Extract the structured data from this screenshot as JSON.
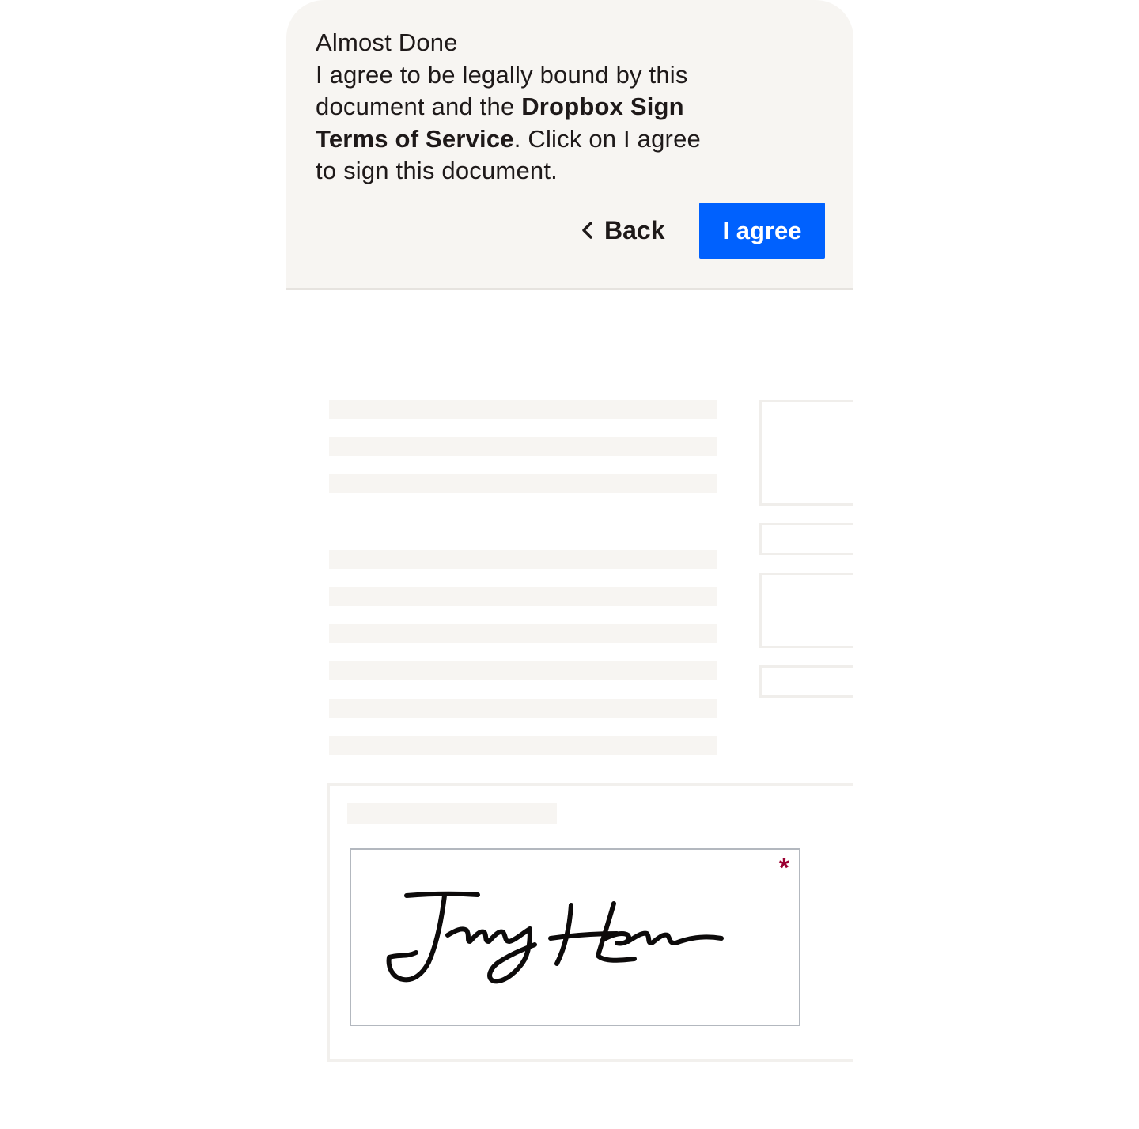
{
  "consent": {
    "title": "Almost Done",
    "body_prefix": "I agree to be legally bound by this document and the ",
    "terms_link": "Dropbox Sign Terms of Service",
    "body_suffix": ". Click on I agree to sign this document.",
    "back_label": "Back",
    "agree_label": "I agree"
  },
  "signature": {
    "required_marker": "*",
    "signature_image": "handwritten-signature"
  },
  "icons": {
    "back": "chevron-left-icon"
  },
  "colors": {
    "accent": "#0061fe",
    "panel_bg": "#f7f5f2",
    "required": "#9b0032",
    "text": "#1e1919"
  }
}
